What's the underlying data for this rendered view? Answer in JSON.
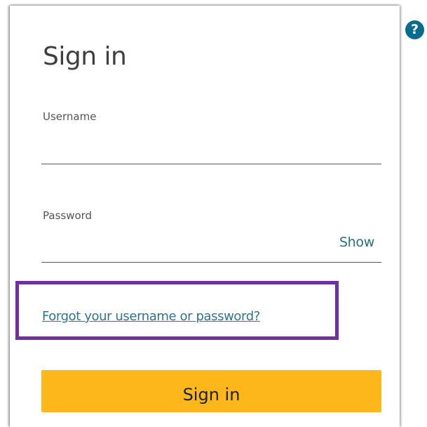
{
  "help": {
    "glyph": "?",
    "icon": "question-mark-circle",
    "color": "#0b6b8f"
  },
  "form": {
    "title": "Sign in",
    "username": {
      "label": "Username",
      "value": "",
      "placeholder": ""
    },
    "password": {
      "label": "Password",
      "value": "",
      "placeholder": "",
      "toggle_label": "Show"
    },
    "forgot_link": "Forgot your username or password?",
    "submit_label": "Sign in"
  },
  "annotation": {
    "highlight_color": "#7030a0"
  },
  "colors": {
    "accent_button": "#fdb71a",
    "link": "#2a7596"
  }
}
